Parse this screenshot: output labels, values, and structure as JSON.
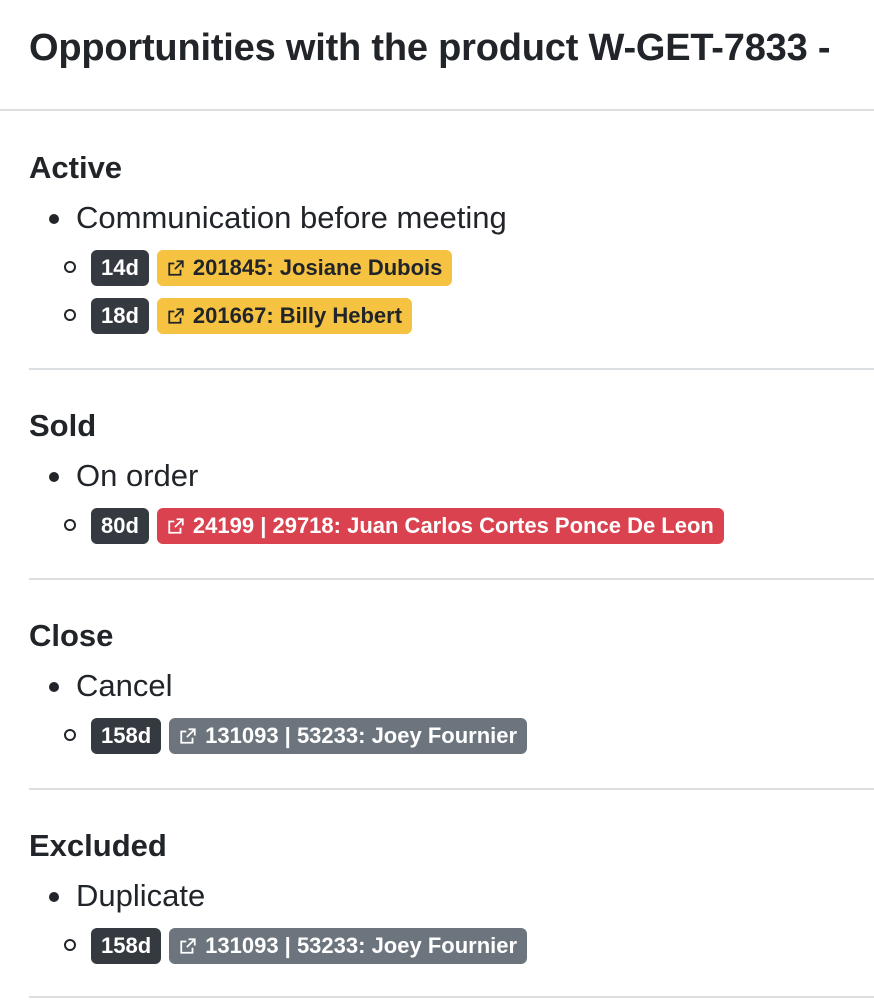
{
  "page": {
    "title": "Opportunities with the product W-GET-7833 -"
  },
  "colors": {
    "age_badge": "#343a40",
    "yellow": "#f5c242",
    "red": "#d9424e",
    "gray": "#6c757d",
    "divider": "#dcdfe2"
  },
  "sections": [
    {
      "title": "Active",
      "status": "Communication before meeting",
      "items": [
        {
          "age": "14d",
          "label": "201845: Josiane Dubois",
          "color": "yellow",
          "icon": "external-link-icon"
        },
        {
          "age": "18d",
          "label": "201667: Billy Hebert",
          "color": "yellow",
          "icon": "external-link-icon"
        }
      ]
    },
    {
      "title": "Sold",
      "status": "On order",
      "items": [
        {
          "age": "80d",
          "label": "24199 | 29718: Juan Carlos Cortes Ponce De Leon",
          "color": "red",
          "icon": "external-link-icon"
        }
      ]
    },
    {
      "title": "Close",
      "status": "Cancel",
      "items": [
        {
          "age": "158d",
          "label": "131093 | 53233: Joey Fournier",
          "color": "gray",
          "icon": "external-link-icon"
        }
      ]
    },
    {
      "title": "Excluded",
      "status": "Duplicate",
      "items": [
        {
          "age": "158d",
          "label": "131093 | 53233: Joey Fournier",
          "color": "gray",
          "icon": "external-link-icon"
        }
      ]
    }
  ]
}
